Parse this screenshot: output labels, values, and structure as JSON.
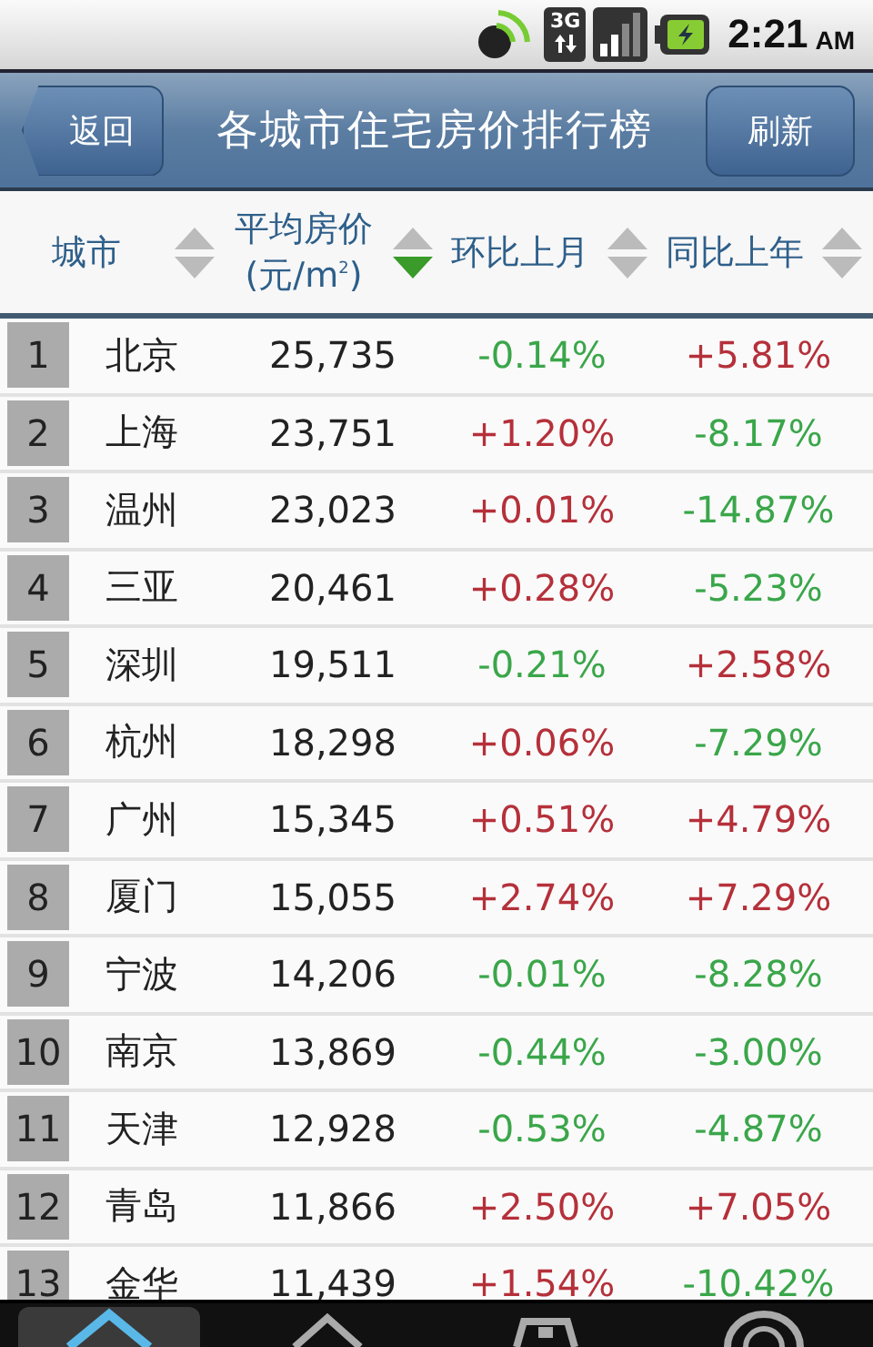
{
  "status_bar": {
    "network": "3G",
    "time": "2:21",
    "meridiem": "AM"
  },
  "title_bar": {
    "back": "返回",
    "title": "各城市住宅房价排行榜",
    "refresh": "刷新"
  },
  "table": {
    "columns": [
      {
        "label": "城市",
        "sorted": false
      },
      {
        "label": "平均房价",
        "sublabel": "(元/m$^{2}$)",
        "sorted": true
      },
      {
        "label": "环比上月",
        "sorted": false
      },
      {
        "label": "同比上年",
        "sorted": false
      }
    ],
    "rows": [
      {
        "rank": "1",
        "city": "北京",
        "price": "25,735",
        "mom": {
          "text": "-0.14%",
          "rising": false
        },
        "yoy": {
          "text": "+5.81%",
          "rising": true
        }
      },
      {
        "rank": "2",
        "city": "上海",
        "price": "23,751",
        "mom": {
          "text": "+1.20%",
          "rising": true
        },
        "yoy": {
          "text": "-8.17%",
          "rising": false
        }
      },
      {
        "rank": "3",
        "city": "温州",
        "price": "23,023",
        "mom": {
          "text": "+0.01%",
          "rising": true
        },
        "yoy": {
          "text": "-14.87%",
          "rising": false
        }
      },
      {
        "rank": "4",
        "city": "三亚",
        "price": "20,461",
        "mom": {
          "text": "+0.28%",
          "rising": true
        },
        "yoy": {
          "text": "-5.23%",
          "rising": false
        }
      },
      {
        "rank": "5",
        "city": "深圳",
        "price": "19,511",
        "mom": {
          "text": "-0.21%",
          "rising": false
        },
        "yoy": {
          "text": "+2.58%",
          "rising": true
        }
      },
      {
        "rank": "6",
        "city": "杭州",
        "price": "18,298",
        "mom": {
          "text": "+0.06%",
          "rising": true
        },
        "yoy": {
          "text": "-7.29%",
          "rising": false
        }
      },
      {
        "rank": "7",
        "city": "广州",
        "price": "15,345",
        "mom": {
          "text": "+0.51%",
          "rising": true
        },
        "yoy": {
          "text": "+4.79%",
          "rising": true
        }
      },
      {
        "rank": "8",
        "city": "厦门",
        "price": "15,055",
        "mom": {
          "text": "+2.74%",
          "rising": true
        },
        "yoy": {
          "text": "+7.29%",
          "rising": true
        }
      },
      {
        "rank": "9",
        "city": "宁波",
        "price": "14,206",
        "mom": {
          "text": "-0.01%",
          "rising": false
        },
        "yoy": {
          "text": "-8.28%",
          "rising": false
        }
      },
      {
        "rank": "10",
        "city": "南京",
        "price": "13,869",
        "mom": {
          "text": "-0.44%",
          "rising": false
        },
        "yoy": {
          "text": "-3.00%",
          "rising": false
        }
      },
      {
        "rank": "11",
        "city": "天津",
        "price": "12,928",
        "mom": {
          "text": "-0.53%",
          "rising": false
        },
        "yoy": {
          "text": "-4.87%",
          "rising": false
        }
      },
      {
        "rank": "12",
        "city": "青岛",
        "price": "11,866",
        "mom": {
          "text": "+2.50%",
          "rising": true
        },
        "yoy": {
          "text": "+7.05%",
          "rising": true
        }
      },
      {
        "rank": "13",
        "city": "金华",
        "price": "11,439",
        "mom": {
          "text": "+1.54%",
          "rising": true
        },
        "yoy": {
          "text": "-10.42%",
          "rising": false
        }
      }
    ]
  },
  "tab_bar": {
    "tabs": [
      {
        "selected": true
      },
      {
        "selected": false
      },
      {
        "selected": false
      },
      {
        "selected": false
      }
    ]
  }
}
